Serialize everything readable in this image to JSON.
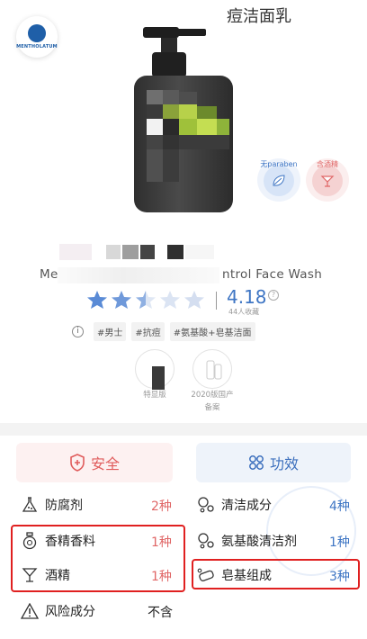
{
  "brand": {
    "logo_text": "MENTHOLATUM"
  },
  "badges": {
    "paraben": "无paraben",
    "alcohol": "含酒精"
  },
  "product": {
    "title": "痘洁面乳",
    "subtitle_left": "Me",
    "subtitle_right": "ntrol Face Wash"
  },
  "rating": {
    "score": "4.18",
    "stars": 2.5,
    "count_label": "44人收藏",
    "help": "?"
  },
  "tags": [
    "#男士",
    "#抗痘",
    "#氨基酸+皂基洁面"
  ],
  "certs": [
    {
      "label": "特显版"
    },
    {
      "label": "2020版国产备案"
    }
  ],
  "tabs": {
    "safety": "安全",
    "efficacy": "功效"
  },
  "safety_items": [
    {
      "label": "防腐剂",
      "value": "2种",
      "icon": "flask-icon"
    },
    {
      "label": "香精香料",
      "value": "1种",
      "icon": "perfume-icon"
    },
    {
      "label": "酒精",
      "value": "1种",
      "icon": "cocktail-icon"
    },
    {
      "label": "风险成分",
      "value": "不含",
      "icon": "warning-icon"
    }
  ],
  "efficacy_items": [
    {
      "label": "清洁成分",
      "value": "4种",
      "icon": "bubbles-icon"
    },
    {
      "label": "氨基酸清洁剂",
      "value": "1种",
      "icon": "bubbles-icon"
    },
    {
      "label": "皂基组成",
      "value": "3种",
      "icon": "soap-icon"
    }
  ],
  "colors": {
    "accent_blue": "#3f76c4",
    "accent_red": "#e06666",
    "highlight": "#e02020"
  }
}
